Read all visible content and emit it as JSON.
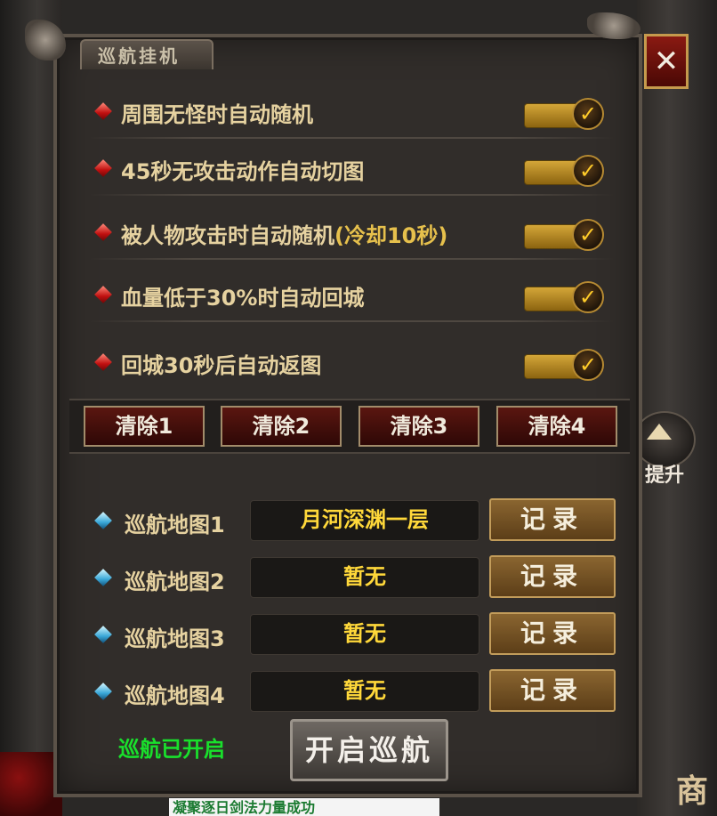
{
  "panel": {
    "title": "巡航挂机",
    "close_symbol": "✕"
  },
  "options": [
    {
      "label": "周围无怪时自动随机",
      "checked": true
    },
    {
      "label": "45秒无攻击动作自动切图",
      "checked": true
    },
    {
      "label": "被人物攻击时自动随机",
      "highlight": "(冷却10秒)",
      "checked": true
    },
    {
      "label": "血量低于30%时自动回城",
      "checked": true
    },
    {
      "label": "回城30秒后自动返图",
      "checked": true
    }
  ],
  "clear_buttons": [
    "清除1",
    "清除2",
    "清除3",
    "清除4"
  ],
  "maps": [
    {
      "label": "巡航地图1",
      "value": "月河深渊一层",
      "button": "记录"
    },
    {
      "label": "巡航地图2",
      "value": "暂无",
      "button": "记录"
    },
    {
      "label": "巡航地图3",
      "value": "暂无",
      "button": "记录"
    },
    {
      "label": "巡航地图4",
      "value": "暂无",
      "button": "记录"
    }
  ],
  "footer": {
    "status": "巡航已开启",
    "start_button": "开启巡航"
  },
  "background": {
    "side_button_label": "提升",
    "toast": "凝聚逐日剑法力量成功",
    "corner_glyph": "商"
  },
  "colors": {
    "label_gold": "#e6d2a0",
    "value_yellow": "#ffd83a",
    "status_green": "#19e02c",
    "accent_red": "#c01010"
  }
}
